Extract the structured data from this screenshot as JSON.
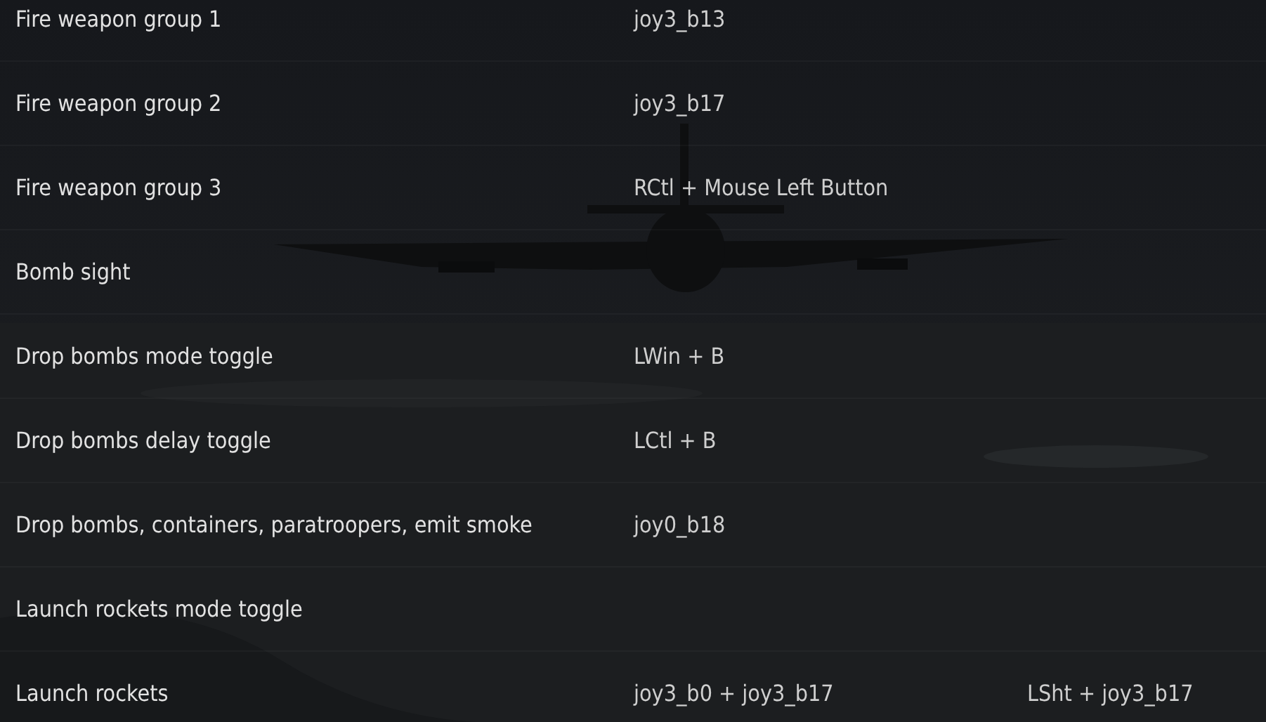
{
  "controls": [
    {
      "action": "Fire weapon group 1",
      "bindings": [
        "joy3_b13"
      ]
    },
    {
      "action": "Fire weapon group 2",
      "bindings": [
        "joy3_b17"
      ]
    },
    {
      "action": "Fire weapon group 3",
      "bindings": [
        "RCtl + Mouse Left Button"
      ]
    },
    {
      "action": "Bomb sight"
    },
    {
      "action": "Drop bombs mode toggle",
      "bindings": [
        "LWin + B"
      ]
    },
    {
      "action": "Drop bombs delay toggle",
      "bindings": [
        "LCtl + B"
      ]
    },
    {
      "action": "Drop bombs, containers, paratroopers, emit smoke",
      "bindings": [
        "joy0_b18"
      ]
    },
    {
      "action": "Launch rockets mode toggle"
    },
    {
      "action": "Launch rockets",
      "bindings": [
        "joy3_b0 + joy3_b17",
        "LSht + joy3_b17"
      ]
    }
  ]
}
